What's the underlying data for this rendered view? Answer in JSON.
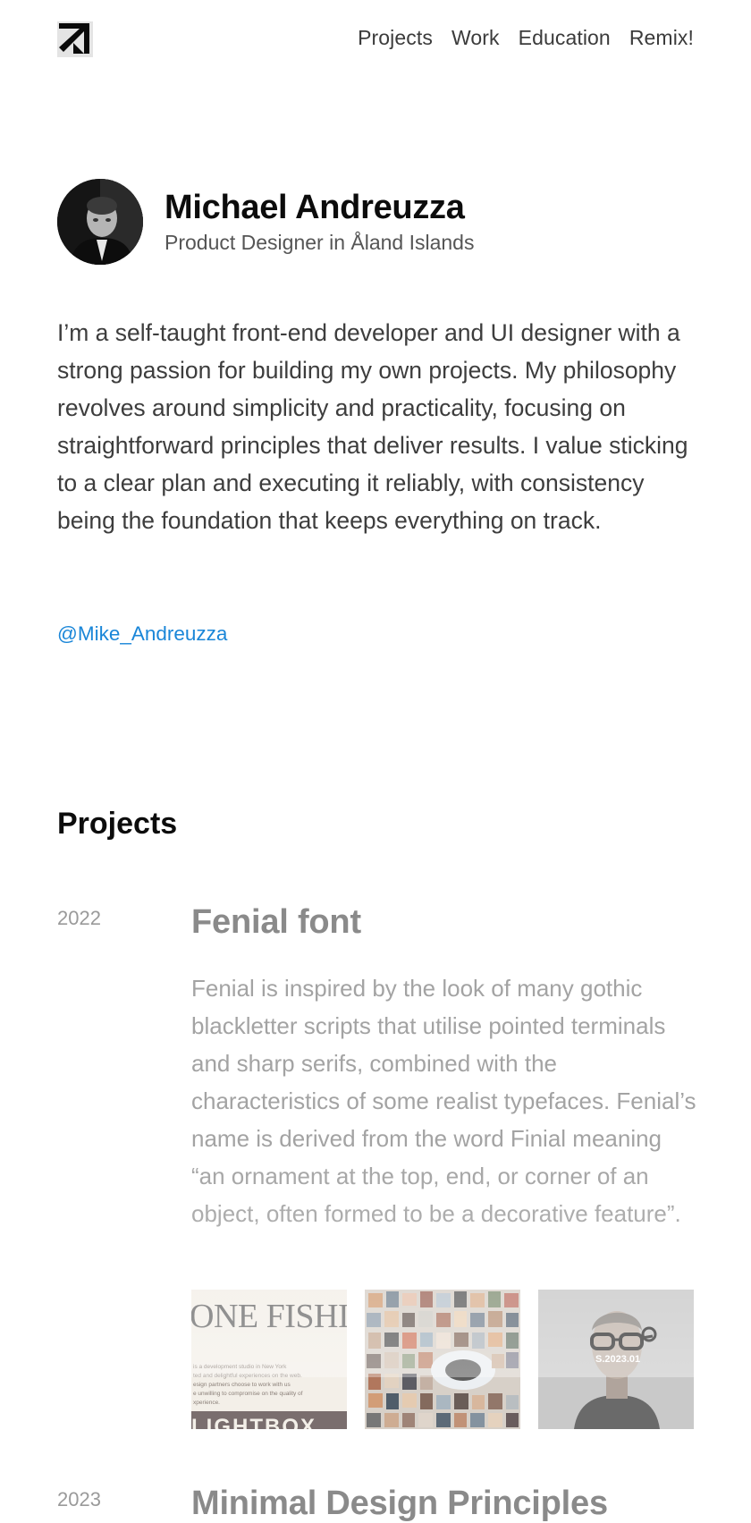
{
  "nav": {
    "logo_icon": "arrow-logo-icon",
    "items": [
      "Projects",
      "Work",
      "Education",
      "Remix!"
    ]
  },
  "profile": {
    "name": "Michael Andreuzza",
    "role": "Product Designer in Åland Islands",
    "avatar_icon": "portrait-photo"
  },
  "bio": "I’m a self-taught front-end developer and UI designer with a strong passion for building my own projects. My philosophy revolves around simplicity and practicality, focusing on straightforward principles that deliver results. I value sticking to a clear plan and executing it reliably, with consistency being the foundation that keeps everything on track.",
  "handle": "@Mike_Andreuzza",
  "projects_section": {
    "title": "Projects",
    "items": [
      {
        "year": "2022",
        "title": "Fenial font",
        "description": "Fenial is inspired by the look of many gothic blackletter scripts that utilise pointed terminals and sharp serifs, combined with the characteristics of some realist typefaces. Fenial’s name is derived from the word Finial meaning “an ornament at the top, end, or corner of an object, often formed to be a decorative feature”.",
        "thumbnails": [
          {
            "headline": "ONE FISHIN",
            "lines": [
              "is a development studio in New York",
              "ted and delightful experiences on the web.",
              "esign partners choose to work with us",
              "e unwilling to compromise on the quality of",
              "xperience."
            ],
            "footer": "LIGHTBOX"
          },
          {
            "kind": "photo-grid"
          },
          {
            "caption": "S.2023.01"
          }
        ]
      },
      {
        "year": "2023",
        "title": "Minimal Design Principles"
      }
    ]
  },
  "colors": {
    "link": "#1a86d8",
    "text": "#3d3d3d",
    "muted": "#a3a3a3"
  }
}
